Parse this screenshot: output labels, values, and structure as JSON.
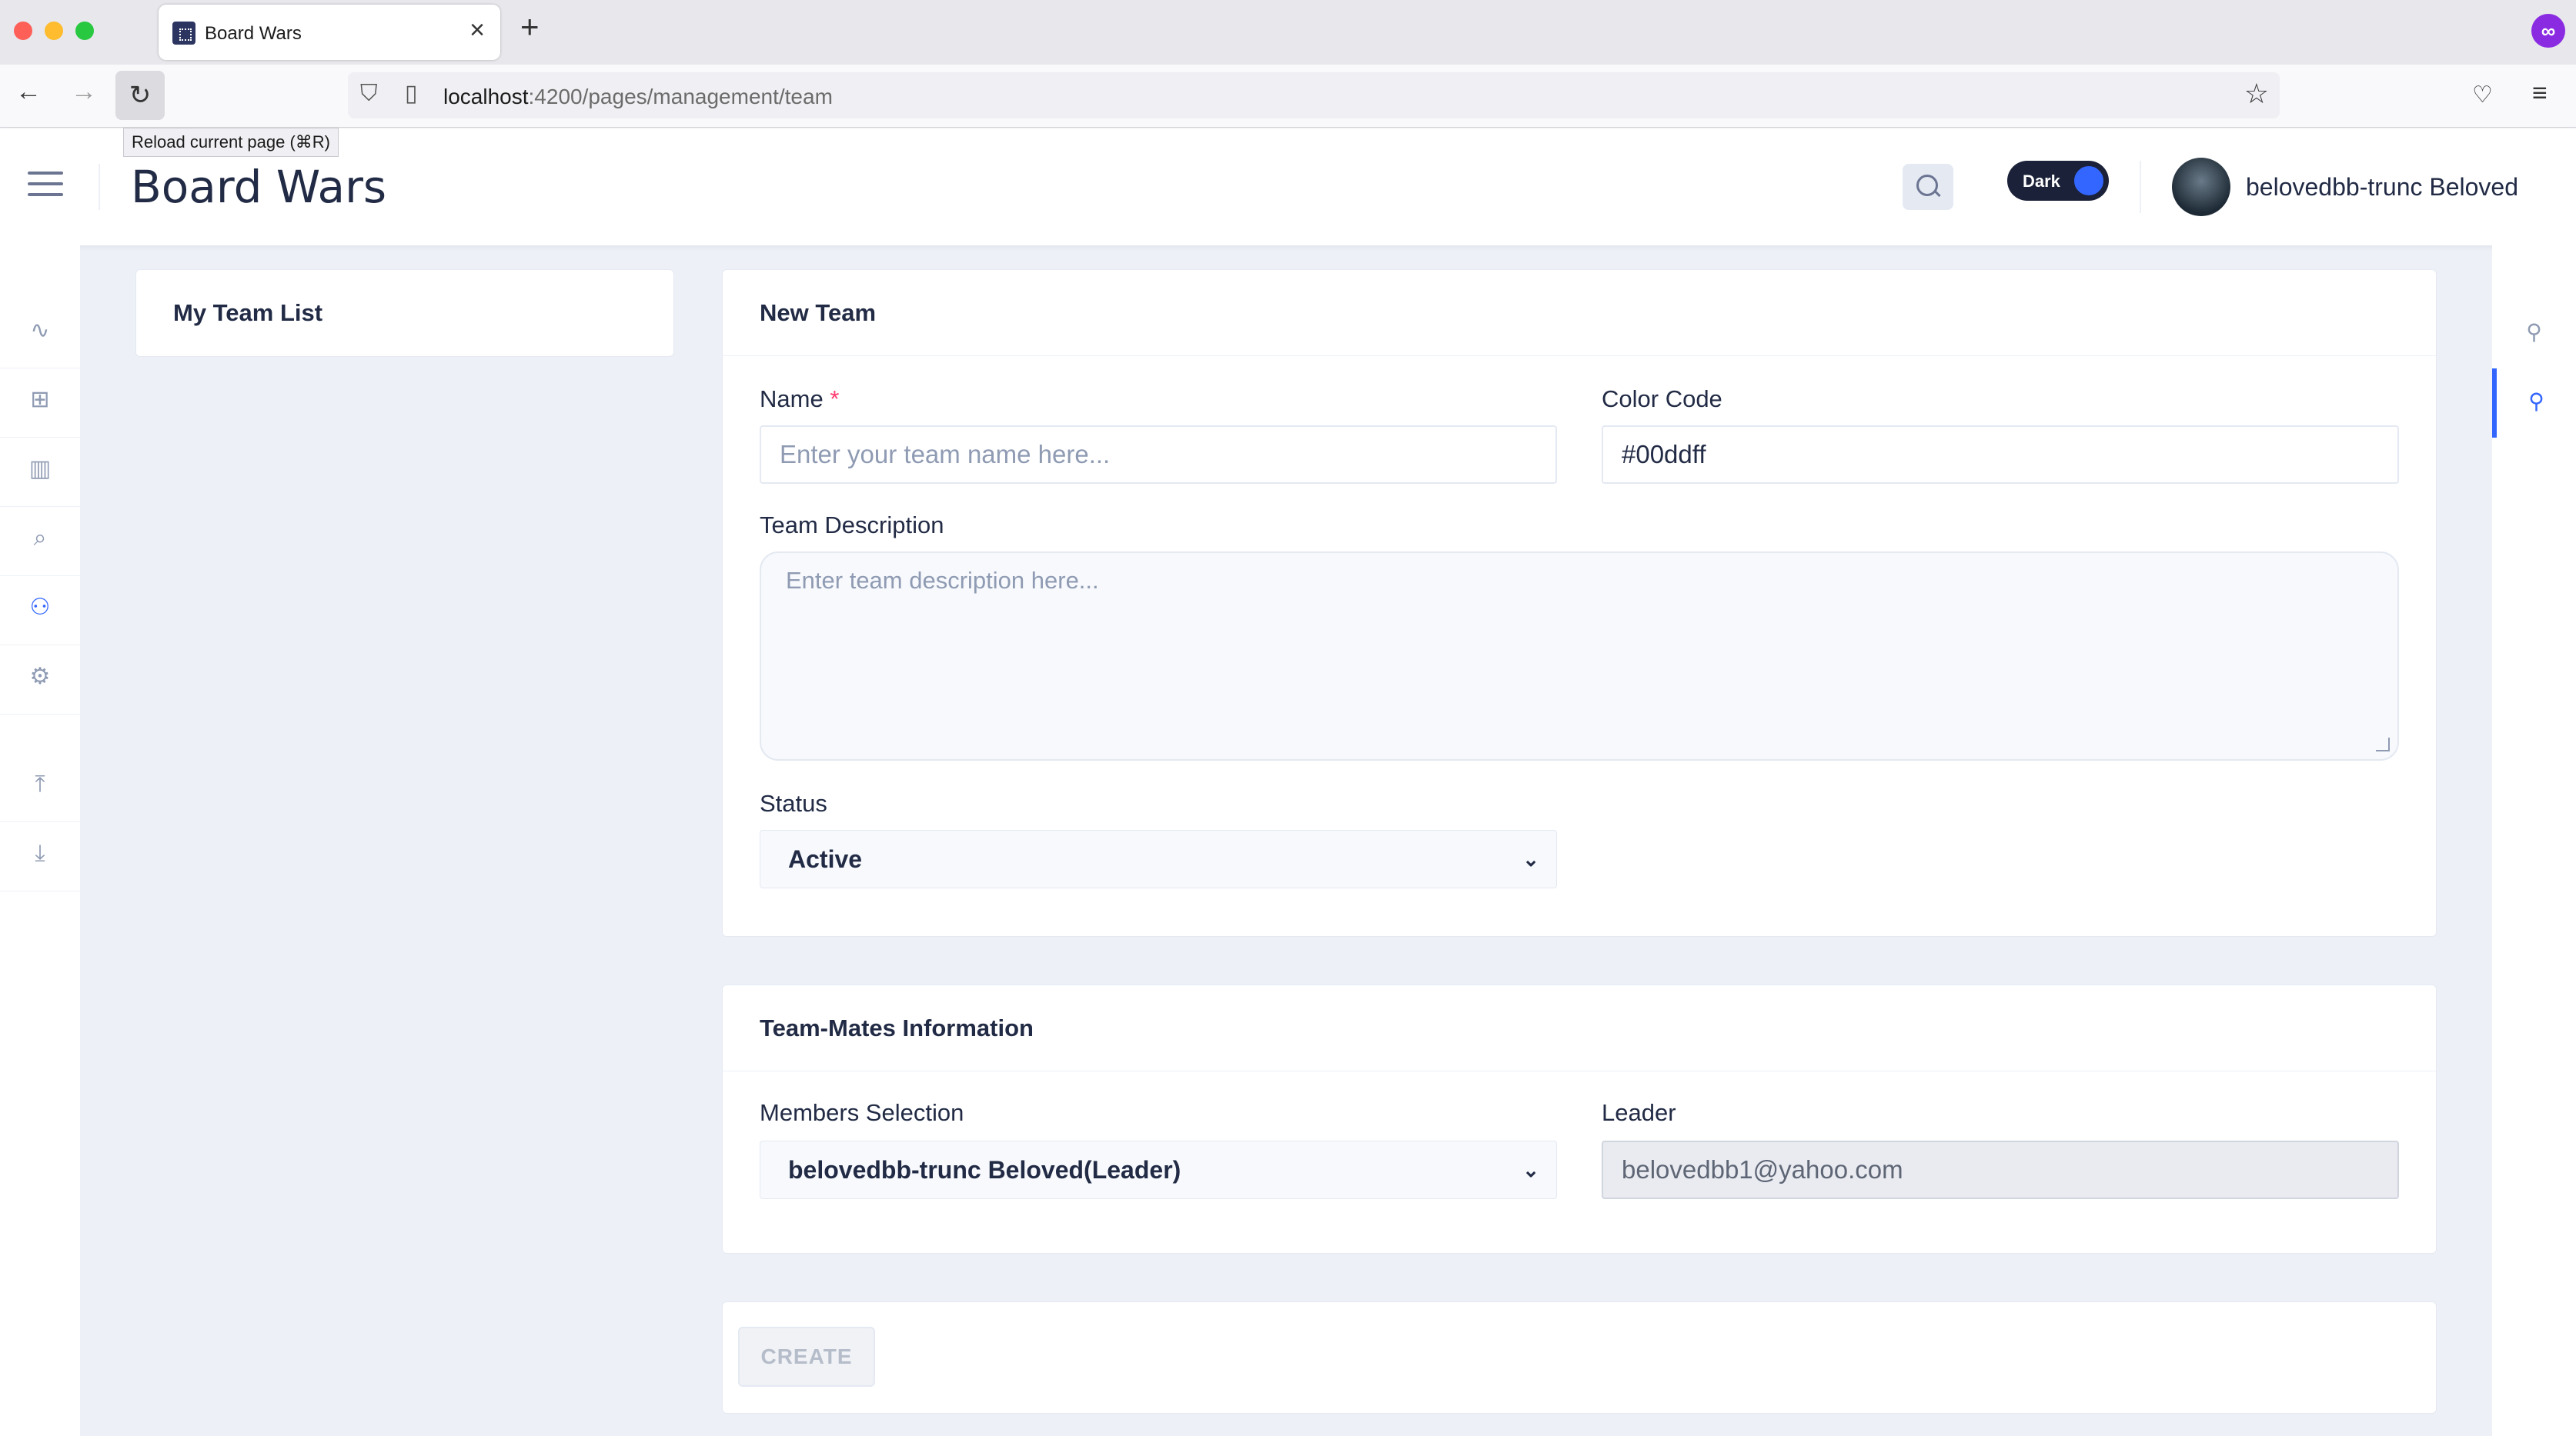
{
  "browser": {
    "tab_title": "Board Wars",
    "url_host": "localhost",
    "url_path": ":4200/pages/management/team",
    "tooltip": "Reload current page (⌘R)"
  },
  "header": {
    "title": "Board Wars",
    "theme_label": "Dark",
    "user_name": "belovedbb-trunc Beloved"
  },
  "team_list": {
    "title": "My Team List"
  },
  "new_team": {
    "title": "New Team",
    "name_label": "Name",
    "required_mark": "*",
    "name_placeholder": "Enter your team name here...",
    "color_label": "Color Code",
    "color_value": "#00ddff",
    "description_label": "Team Description",
    "description_placeholder": "Enter team description here...",
    "status_label": "Status",
    "status_value": "Active"
  },
  "team_mates": {
    "title": "Team-Mates Information",
    "members_label": "Members Selection",
    "members_value": "belovedbb-trunc Beloved(Leader)",
    "leader_label": "Leader",
    "leader_value": "belovedbb1@yahoo.com"
  },
  "actions": {
    "create_label": "CREATE"
  },
  "colors": {
    "accent": "#3366ff",
    "required": "#ff3d71",
    "background": "#edf1f7"
  }
}
